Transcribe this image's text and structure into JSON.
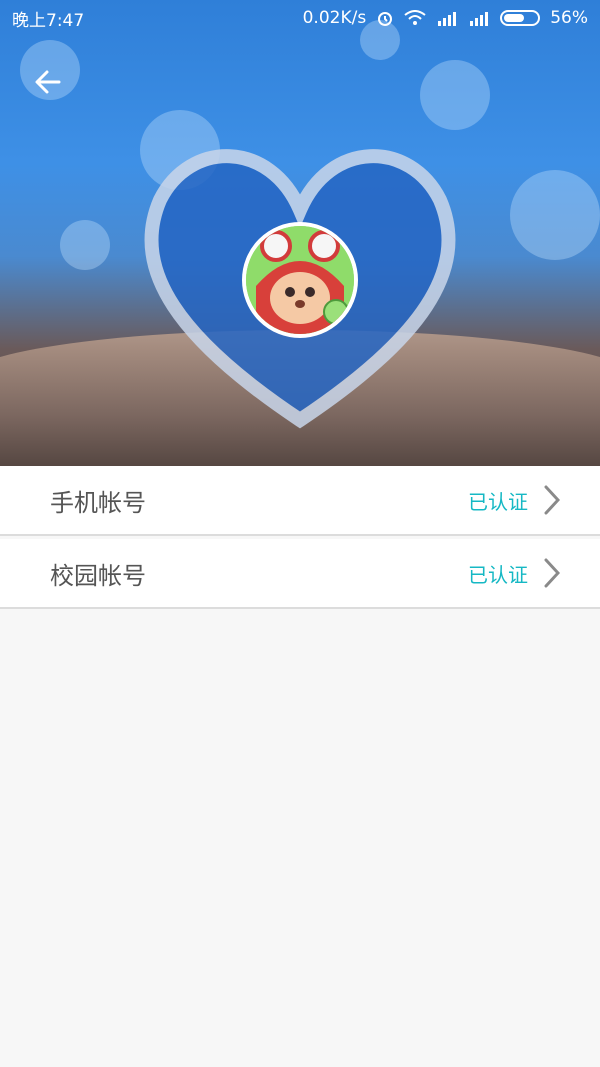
{
  "status_bar": {
    "time": "晚上7:47",
    "network_speed": "0.02K/s",
    "battery": "56%"
  },
  "header": {
    "back_icon": "arrow-left-icon"
  },
  "accounts": [
    {
      "label": "手机帐号",
      "status": "已认证"
    },
    {
      "label": "校园帐号",
      "status": "已认证"
    }
  ],
  "colors": {
    "accent": "#16b8c4",
    "background": "#f7f7f7"
  }
}
